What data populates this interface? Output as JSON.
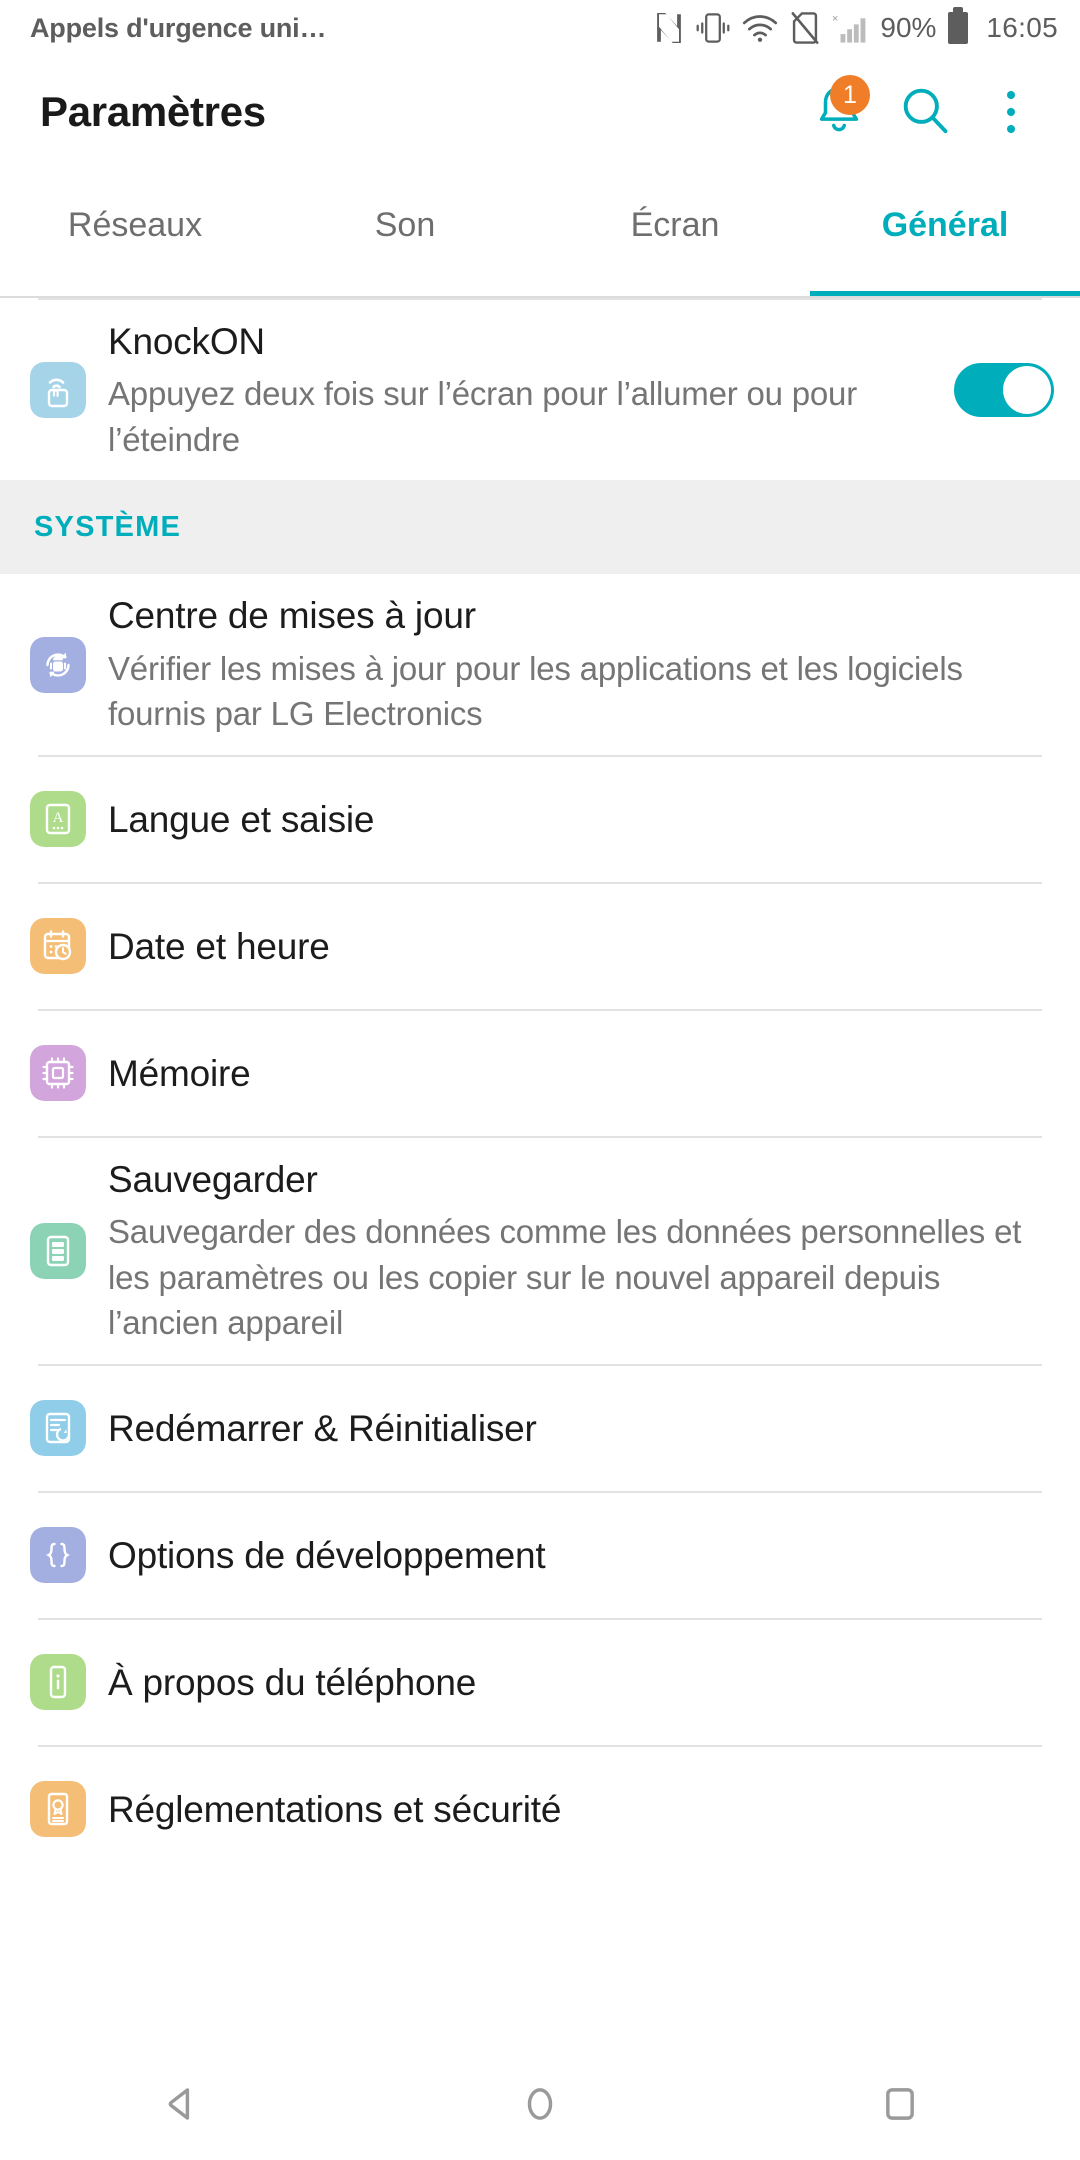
{
  "status_bar": {
    "carrier": "Appels d'urgence uni…",
    "battery_percent": "90%",
    "clock": "16:05",
    "icons": [
      "nfc-icon",
      "vibrate-icon",
      "wifi-icon",
      "no-sim-icon",
      "signal-icon",
      "battery-icon"
    ]
  },
  "app_bar": {
    "title": "Paramètres",
    "notification_badge": "1",
    "notifications_icon": "bell-icon",
    "search_icon": "search-icon",
    "overflow_icon": "kebab-menu-icon"
  },
  "tabs": [
    {
      "label": "Réseaux",
      "active": false
    },
    {
      "label": "Son",
      "active": false
    },
    {
      "label": "Écran",
      "active": false
    },
    {
      "label": "Général",
      "active": true
    }
  ],
  "knockon": {
    "title": "KnockON",
    "subtitle": "Appuyez deux fois sur l’écran pour l’allumer ou pour l’éteindre",
    "toggle_on": true,
    "icon": "knock-tap-icon",
    "icon_bg": "#A5D3E8"
  },
  "section": {
    "label": "SYSTÈME"
  },
  "items": [
    {
      "title": "Centre de mises à jour",
      "subtitle": "Vérifier les mises à jour pour les applications et les logiciels fournis par LG Electronics",
      "icon": "update-center-icon",
      "icon_bg": "#A3AFE0"
    },
    {
      "title": "Langue et saisie",
      "subtitle": "",
      "icon": "language-input-icon",
      "icon_bg": "#AEDC8A"
    },
    {
      "title": "Date et heure",
      "subtitle": "",
      "icon": "date-time-icon",
      "icon_bg": "#F5BE76"
    },
    {
      "title": "Mémoire",
      "subtitle": "",
      "icon": "memory-chip-icon",
      "icon_bg": "#D2A6DC"
    },
    {
      "title": "Sauvegarder",
      "subtitle": "Sauvegarder des données comme les données personnelles et les paramètres ou les copier sur le nouvel appareil depuis l’ancien appareil",
      "icon": "backup-icon",
      "icon_bg": "#8CD2B5"
    },
    {
      "title": "Redémarrer & Réinitialiser",
      "subtitle": "",
      "icon": "restart-reset-icon",
      "icon_bg": "#8FCDE8"
    },
    {
      "title": "Options de développement",
      "subtitle": "",
      "icon": "developer-braces-icon",
      "icon_bg": "#A3AFE0"
    },
    {
      "title": "À propos du téléphone",
      "subtitle": "",
      "icon": "about-phone-icon",
      "icon_bg": "#AEDC8A"
    },
    {
      "title": "Réglementations et sécurité",
      "subtitle": "",
      "icon": "regulatory-safety-icon",
      "icon_bg": "#F5BE76"
    }
  ],
  "nav_bar": {
    "back": "back-icon",
    "home": "home-icon",
    "recents": "recents-icon"
  },
  "colors": {
    "accent": "#00ADBB",
    "badge": "#F07D28",
    "section_bg": "#efefef",
    "title_text": "#1c1c1c",
    "subtitle_text": "#757575"
  }
}
